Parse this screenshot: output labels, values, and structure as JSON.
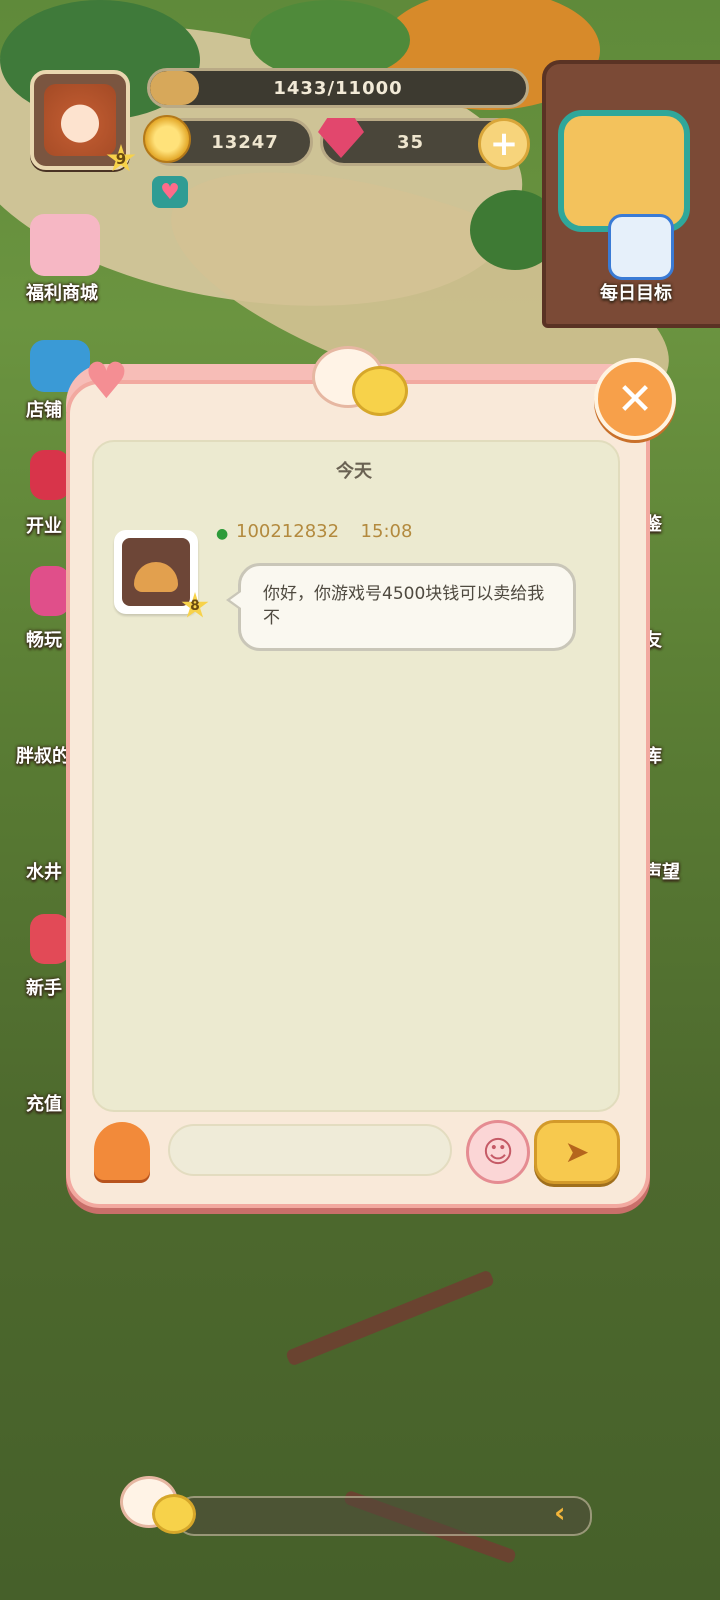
{
  "hud": {
    "player_level": "9",
    "xp_text": "1433/11000",
    "xp_fraction": 0.13,
    "coins": "13247",
    "gems": "35"
  },
  "side_menu": {
    "left": [
      "福利商城",
      "店铺",
      "开业",
      "畅玩",
      "胖叔的",
      "水井",
      "新手",
      "充值"
    ],
    "right": [
      "每日目标",
      "鉴",
      "友",
      "库",
      "声望"
    ]
  },
  "chat": {
    "date_label": "今天",
    "messages": [
      {
        "user_id": "100212832",
        "time": "15:08",
        "sender_level": "8",
        "text": "你好，你游戏号4500块钱可以卖给我不"
      }
    ],
    "input_placeholder": ""
  },
  "colors": {
    "dialog_border": "#f2a9a0",
    "chat_bg": "#ecead0",
    "accent_gold": "#f7c94e",
    "meta_text": "#b38a3e"
  },
  "icons": {
    "close": "close-icon",
    "send": "send-icon",
    "emoji": "emoji-icon",
    "muffin": "muffin-icon",
    "user": "user-icon"
  }
}
